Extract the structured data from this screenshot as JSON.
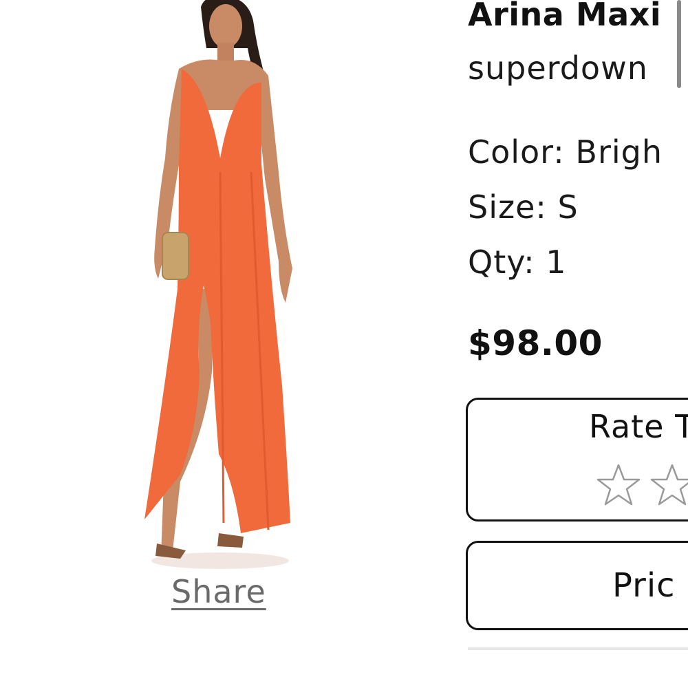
{
  "product": {
    "title": "Arina Maxi",
    "brand": "superdown",
    "color_line": "Color: Brigh",
    "size_line": "Size: S",
    "qty_line": "Qty: 1",
    "price": "$98.00",
    "image_icon": "orange-maxi-dress-photo"
  },
  "share": {
    "label": "Share"
  },
  "rating": {
    "title": "Rate T",
    "star_icon": "star-outline-icon"
  },
  "price_box": {
    "label": "Pric"
  },
  "colors": {
    "dress": "#F16A3C",
    "text": "#111111",
    "share_text": "#6a6a6a",
    "star_outline": "#9a9a9a",
    "divider": "#e6e6e6"
  }
}
